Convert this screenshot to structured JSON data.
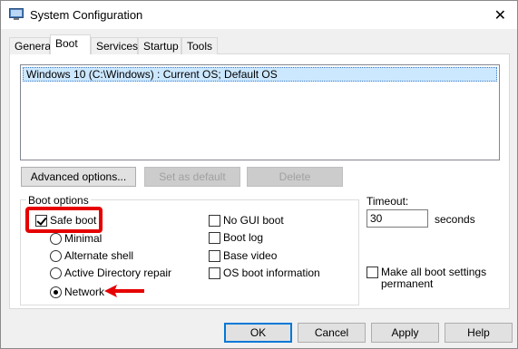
{
  "window": {
    "title": "System Configuration",
    "close_glyph": "✕"
  },
  "tabs": [
    "General",
    "Boot",
    "Services",
    "Startup",
    "Tools"
  ],
  "os_list": {
    "items": [
      "Windows 10 (C:\\Windows) : Current OS; Default OS"
    ]
  },
  "buttons": {
    "advanced": "Advanced options...",
    "set_default": "Set as default",
    "delete": "Delete"
  },
  "boot_options": {
    "label": "Boot options",
    "safe_boot": "Safe boot",
    "radios": [
      "Minimal",
      "Alternate shell",
      "Active Directory repair",
      "Network"
    ],
    "selected_radio": "Network",
    "right_checks": [
      "No GUI boot",
      "Boot log",
      "Base video",
      "OS boot information"
    ]
  },
  "timeout": {
    "label": "Timeout:",
    "value": "30",
    "unit": "seconds"
  },
  "make_permanent": {
    "line1": "Make all boot settings",
    "line2": "permanent"
  },
  "footer": {
    "ok": "OK",
    "cancel": "Cancel",
    "apply": "Apply",
    "help": "Help"
  },
  "colors": {
    "selection": "#cce8ff",
    "annotation_red": "#e60000",
    "default_button_border": "#0078d7"
  }
}
